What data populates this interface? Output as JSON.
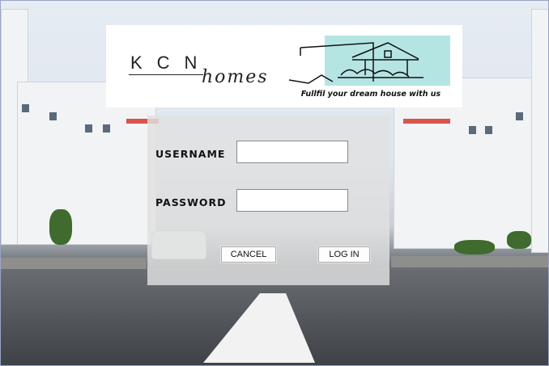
{
  "brand": {
    "name": "KCN",
    "script": "homes",
    "tagline": "Fullfil your dream house with us"
  },
  "login": {
    "username_label": "USERNAME",
    "password_label": "PASSWORD",
    "username_value": "",
    "password_value": "",
    "cancel_label": "CANCEL",
    "login_label": "LOG IN"
  },
  "colors": {
    "banner_accent": "#b5e5e3",
    "panel": "#e1e1e1"
  }
}
